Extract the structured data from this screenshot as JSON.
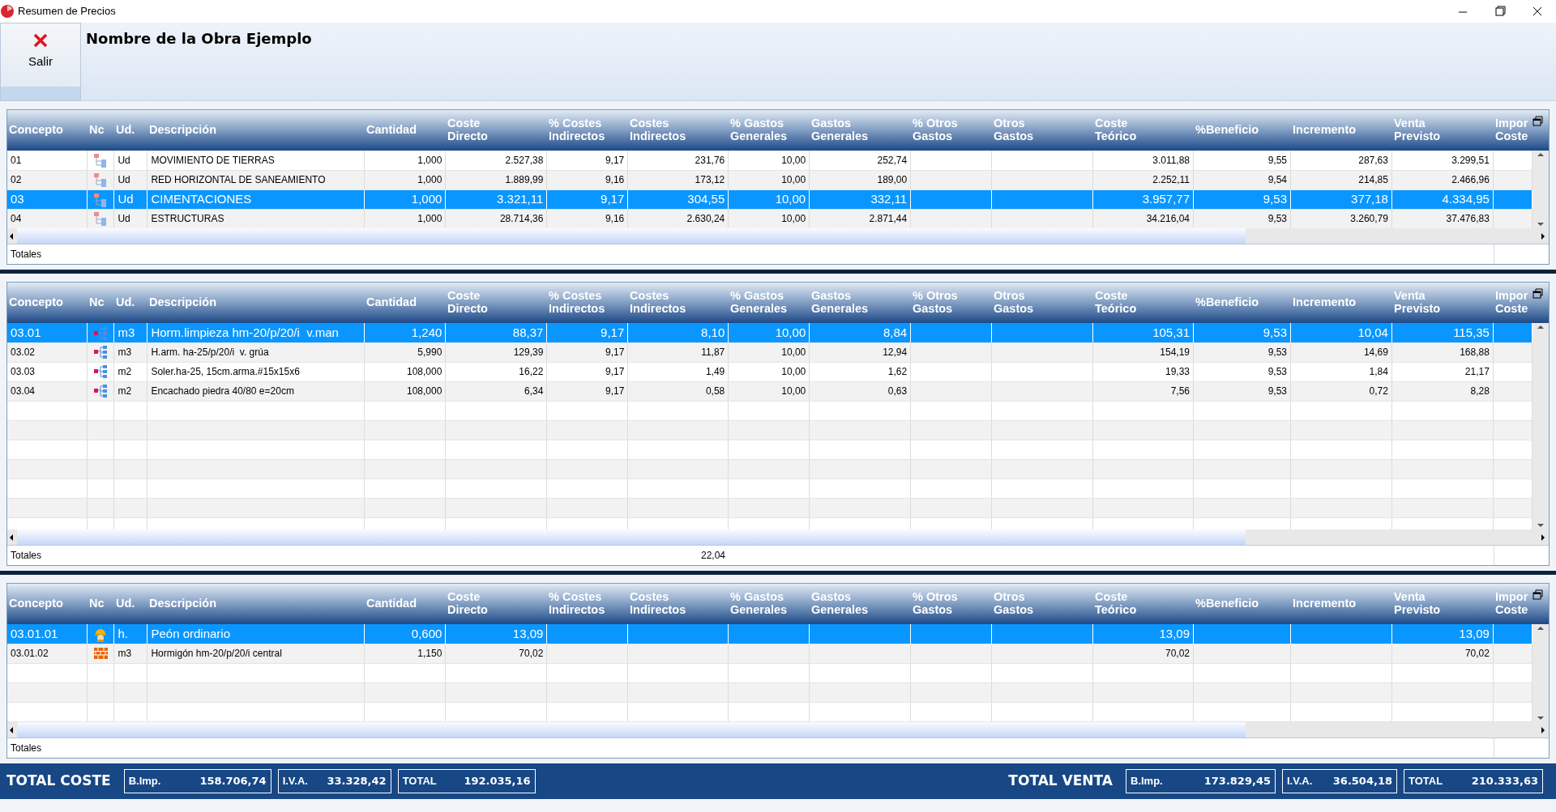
{
  "window": {
    "title": "Resumen de Precios"
  },
  "toolbar": {
    "exit_button": "Salir",
    "project_title": "Nombre de la Obra Ejemplo"
  },
  "grids": [
    {
      "columns": [
        "Concepto",
        "Nc",
        "Ud.",
        "Descripción",
        "Cantidad",
        "Coste\nDirecto",
        "% Costes\nIndirectos",
        "Costes\nIndirectos",
        "% Gastos\nGenerales",
        "Gastos\nGenerales",
        "% Otros\nGastos",
        "Otros\nGastos",
        "Coste\nTeórico",
        "%Beneficio",
        "Incremento",
        "Venta\nPrevisto",
        "Impor\nCoste"
      ],
      "rows": [
        {
          "kind": "chapter",
          "selected": false,
          "concepto": "01",
          "ud": "Ud",
          "descripcion": "MOVIMIENTO DE TIERRAS",
          "cantidad": "1,000",
          "coste_directo": "2.527,38",
          "pct_costes_indirectos": "9,17",
          "costes_indirectos": "231,76",
          "pct_gastos_generales": "10,00",
          "gastos_generales": "252,74",
          "coste_teorico": "3.011,88",
          "pct_beneficio": "9,55",
          "incremento": "287,63",
          "venta_previsto": "3.299,51"
        },
        {
          "kind": "chapter",
          "selected": false,
          "concepto": "02",
          "ud": "Ud",
          "descripcion": "RED HORIZONTAL DE SANEAMIENTO",
          "cantidad": "1,000",
          "coste_directo": "1.889,99",
          "pct_costes_indirectos": "9,16",
          "costes_indirectos": "173,12",
          "pct_gastos_generales": "10,00",
          "gastos_generales": "189,00",
          "coste_teorico": "2.252,11",
          "pct_beneficio": "9,54",
          "incremento": "214,85",
          "venta_previsto": "2.466,96"
        },
        {
          "kind": "chapter",
          "selected": true,
          "concepto": "03",
          "ud": "Ud",
          "descripcion": "CIMENTACIONES",
          "cantidad": "1,000",
          "coste_directo": "3.321,11",
          "pct_costes_indirectos": "9,17",
          "costes_indirectos": "304,55",
          "pct_gastos_generales": "10,00",
          "gastos_generales": "332,11",
          "coste_teorico": "3.957,77",
          "pct_beneficio": "9,53",
          "incremento": "377,18",
          "venta_previsto": "4.334,95"
        },
        {
          "kind": "chapter",
          "selected": false,
          "concepto": "04",
          "ud": "Ud",
          "descripcion": "ESTRUCTURAS",
          "cantidad": "1,000",
          "coste_directo": "28.714,36",
          "pct_costes_indirectos": "9,16",
          "costes_indirectos": "2.630,24",
          "pct_gastos_generales": "10,00",
          "gastos_generales": "2.871,44",
          "coste_teorico": "34.216,04",
          "pct_beneficio": "9,53",
          "incremento": "3.260,79",
          "venta_previsto": "37.476,83"
        }
      ],
      "totals": {
        "label": "Totales"
      }
    },
    {
      "columns": [
        "Concepto",
        "Nc",
        "Ud.",
        "Descripción",
        "Cantidad",
        "Coste\nDirecto",
        "% Costes\nIndirectos",
        "Costes\nIndirectos",
        "% Gastos\nGenerales",
        "Gastos\nGenerales",
        "% Otros\nGastos",
        "Otros\nGastos",
        "Coste\nTeórico",
        "%Beneficio",
        "Incremento",
        "Venta\nPrevisto",
        "Impor\nCoste"
      ],
      "rows": [
        {
          "kind": "item",
          "selected": true,
          "concepto": "03.01",
          "ud": "m3",
          "descripcion": "Horm.limpieza hm-20/p/20/i  v.man",
          "cantidad": "1,240",
          "coste_directo": "88,37",
          "pct_costes_indirectos": "9,17",
          "costes_indirectos": "8,10",
          "pct_gastos_generales": "10,00",
          "gastos_generales": "8,84",
          "coste_teorico": "105,31",
          "pct_beneficio": "9,53",
          "incremento": "10,04",
          "venta_previsto": "115,35"
        },
        {
          "kind": "item",
          "selected": false,
          "concepto": "03.02",
          "ud": "m3",
          "descripcion": "H.arm. ha-25/p/20/i  v. grúa",
          "cantidad": "5,990",
          "coste_directo": "129,39",
          "pct_costes_indirectos": "9,17",
          "costes_indirectos": "11,87",
          "pct_gastos_generales": "10,00",
          "gastos_generales": "12,94",
          "coste_teorico": "154,19",
          "pct_beneficio": "9,53",
          "incremento": "14,69",
          "venta_previsto": "168,88"
        },
        {
          "kind": "item",
          "selected": false,
          "concepto": "03.03",
          "ud": "m2",
          "descripcion": "Soler.ha-25, 15cm.arma.#15x15x6",
          "cantidad": "108,000",
          "coste_directo": "16,22",
          "pct_costes_indirectos": "9,17",
          "costes_indirectos": "1,49",
          "pct_gastos_generales": "10,00",
          "gastos_generales": "1,62",
          "coste_teorico": "19,33",
          "pct_beneficio": "9,53",
          "incremento": "1,84",
          "venta_previsto": "21,17"
        },
        {
          "kind": "item",
          "selected": false,
          "concepto": "03.04",
          "ud": "m2",
          "descripcion": "Encachado piedra 40/80 e=20cm",
          "cantidad": "108,000",
          "coste_directo": "6,34",
          "pct_costes_indirectos": "9,17",
          "costes_indirectos": "0,58",
          "pct_gastos_generales": "10,00",
          "gastos_generales": "0,63",
          "coste_teorico": "7,56",
          "pct_beneficio": "9,53",
          "incremento": "0,72",
          "venta_previsto": "8,28"
        }
      ],
      "totals": {
        "label": "Totales",
        "costes_indirectos": "22,04"
      }
    },
    {
      "columns": [
        "Concepto",
        "Nc",
        "Ud.",
        "Descripción",
        "Cantidad",
        "Coste\nDirecto",
        "% Costes\nIndirectos",
        "Costes\nIndirectos",
        "% Gastos\nGenerales",
        "Gastos\nGenerales",
        "% Otros\nGastos",
        "Otros\nGastos",
        "Coste\nTeórico",
        "%Beneficio",
        "Incremento",
        "Venta\nPrevisto",
        "Impor\nCoste"
      ],
      "rows": [
        {
          "kind": "labor",
          "selected": true,
          "concepto": "03.01.01",
          "ud": "h.",
          "descripcion": "Peón ordinario",
          "cantidad": "0,600",
          "coste_directo": "13,09",
          "coste_teorico": "13,09",
          "venta_previsto": "13,09"
        },
        {
          "kind": "material",
          "selected": false,
          "concepto": "03.01.02",
          "ud": "m3",
          "descripcion": "Hormigón hm-20/p/20/i central",
          "cantidad": "1,150",
          "coste_directo": "70,02",
          "coste_teorico": "70,02",
          "venta_previsto": "70,02"
        }
      ],
      "totals": {
        "label": "Totales"
      }
    }
  ],
  "footer": {
    "cost": {
      "title": "TOTAL COSTE",
      "fields": [
        {
          "label": "B.Imp.",
          "value": "158.706,74"
        },
        {
          "label": "I.V.A.",
          "value": "33.328,42"
        },
        {
          "label": "TOTAL",
          "value": "192.035,16"
        }
      ]
    },
    "sale": {
      "title": "TOTAL VENTA",
      "fields": [
        {
          "label": "B.Imp.",
          "value": "173.829,45"
        },
        {
          "label": "I.V.A.",
          "value": "36.504,18"
        },
        {
          "label": "TOTAL",
          "value": "210.333,63"
        }
      ]
    }
  }
}
